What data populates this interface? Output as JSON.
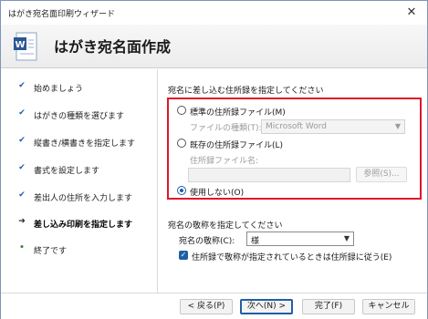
{
  "window": {
    "title": "はがき宛名面印刷ウィザード",
    "close_glyph": "✕"
  },
  "header": {
    "heading": "はがき宛名面作成"
  },
  "sidebar": {
    "steps": [
      {
        "label": "始めましょう",
        "mark": "✔",
        "state": "done"
      },
      {
        "label": "はがきの種類を選びます",
        "mark": "✔",
        "state": "done"
      },
      {
        "label": "縦書き/横書きを指定します",
        "mark": "✔",
        "state": "done"
      },
      {
        "label": "書式を設定します",
        "mark": "✔",
        "state": "done"
      },
      {
        "label": "差出人の住所を入力します",
        "mark": "✔",
        "state": "done"
      },
      {
        "label": "差し込み印刷を指定します",
        "mark": "➔",
        "state": "current"
      },
      {
        "label": "終了です",
        "mark": "•",
        "state": "pending"
      }
    ]
  },
  "address_source": {
    "section_label": "宛名に差し込む住所録を指定してください",
    "option_standard": "標準の住所録ファイル(M)",
    "file_type_label": "ファイルの種類(T):",
    "file_type_value": "Microsoft Word",
    "option_existing": "既存の住所録ファイル(L)",
    "file_name_label": "住所録ファイル名:",
    "browse_label": "参照(S)...",
    "option_none": "使用しない(O)",
    "selected": "none"
  },
  "honorific": {
    "section_label": "宛名の敬称を指定してください",
    "honorific_label": "宛名の敬称(C):",
    "honorific_value": "様",
    "checkbox_label": "住所録で敬称が指定されているときは住所録に従う(E)",
    "checkbox_checked": true
  },
  "footer": {
    "back_label": "< 戻る(P)",
    "next_label": "次へ(N) >",
    "finish_label": "完了(F)",
    "cancel_label": "キャンセル"
  },
  "colors": {
    "accent": "#1f5fa8",
    "highlight_border": "#e0162b"
  }
}
